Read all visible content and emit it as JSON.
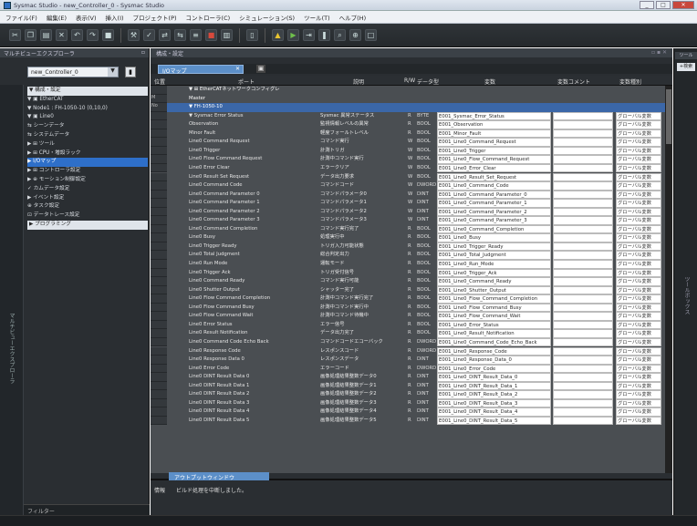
{
  "window": {
    "title": "Sysmac Studio - new_Controller_0 - Sysmac Studio"
  },
  "menu": [
    "ファイル(F)",
    "編集(E)",
    "表示(V)",
    "挿入(I)",
    "プロジェクト(P)",
    "コントローラ(C)",
    "シミュレーション(S)",
    "ツール(T)",
    "ヘルプ(H)"
  ],
  "left": {
    "title": "マルチビューエクスプローラ",
    "controller": "new_Controller_0",
    "vertical_label": "マルチビューエクスプローラ",
    "tree": [
      {
        "label": "▼ 構成・設定",
        "type": "hdr"
      },
      {
        "label": "  ▼ ▣ EtherCAT"
      },
      {
        "label": "    ▼ Node1 : FH-1050-10 (0,10,0)"
      },
      {
        "label": "      ▼ ▣ Line0"
      },
      {
        "label": "          ⇆ シーンデータ"
      },
      {
        "label": "          ⇆ システムデータ"
      },
      {
        "label": "        ▶ ⊞ ツール"
      },
      {
        "label": "  ▶ ⊞ CPU・増設ラック"
      },
      {
        "label": "  ▶ I/Oマップ",
        "type": "sel"
      },
      {
        "label": "  ▶ ⊞ コントローラ設定"
      },
      {
        "label": "  ▶ ⊕ モーション制御設定"
      },
      {
        "label": "     ✓ カムデータ設定"
      },
      {
        "label": "  ▶ イベント設定"
      },
      {
        "label": "     ⊕ タスク設定"
      },
      {
        "label": "     ⊡ データトレース設定"
      },
      {
        "label": "▶ プログラミング",
        "type": "hdr"
      }
    ],
    "filter": "フィルター"
  },
  "main": {
    "title": "構成・設定",
    "tab": "I/Oマップ",
    "columns": {
      "pos": "位置",
      "port": "ポート",
      "desc": "説明",
      "rw": "R/W",
      "dtype": "データ型",
      "var": "変数",
      "vcomment": "変数コメント",
      "vtype": "変数種別"
    },
    "rows": [
      {
        "port": "▼ ⊞ EtherCATネットワークコンフィグレ",
        "grp": true
      },
      {
        "pos": "M",
        "port": "   Master",
        "grp": true
      },
      {
        "pos": "No",
        "port": "  ▼ FH-1050-10",
        "hl": true
      },
      {
        "port": "     ▼ Sysmac Error Status",
        "desc": "Sysmac 異常ステータス",
        "rw": "R",
        "dtype": "BYTE",
        "var": "E001_Sysmac_Error_Status",
        "vtype": "グローバル変数"
      },
      {
        "port": "          Observation",
        "desc": "監視情報レベルの異常",
        "rw": "R",
        "dtype": "BOOL",
        "var": "E001_Observation",
        "vtype": "グローバル変数"
      },
      {
        "port": "          Minor Fault",
        "desc": "軽度フォールトレベル",
        "rw": "R",
        "dtype": "BOOL",
        "var": "E001_Minor_Fault",
        "vtype": "グローバル変数"
      },
      {
        "port": "     Line0 Command Request",
        "desc": "コマンド実行",
        "rw": "W",
        "dtype": "BOOL",
        "var": "E001_Line0_Command_Request",
        "vtype": "グローバル変数"
      },
      {
        "port": "     Line0 Trigger",
        "desc": "計測トリガ",
        "rw": "W",
        "dtype": "BOOL",
        "var": "E001_Line0_Trigger",
        "vtype": "グローバル変数"
      },
      {
        "port": "     Line0 Flow Command Request",
        "desc": "計測中コマンド実行",
        "rw": "W",
        "dtype": "BOOL",
        "var": "E001_Line0_Flow_Command_Request",
        "vtype": "グローバル変数"
      },
      {
        "port": "     Line0 Error Clear",
        "desc": "エラークリア",
        "rw": "W",
        "dtype": "BOOL",
        "var": "E001_Line0_Error_Clear",
        "vtype": "グローバル変数"
      },
      {
        "port": "     Line0 Result Set Request",
        "desc": "データ出力要求",
        "rw": "W",
        "dtype": "BOOL",
        "var": "E001_Line0_Result_Set_Request",
        "vtype": "グローバル変数"
      },
      {
        "port": "     Line0 Command Code",
        "desc": "コマンドコード",
        "rw": "W",
        "dtype": "DWORD",
        "var": "E001_Line0_Command_Code",
        "vtype": "グローバル変数"
      },
      {
        "port": "     Line0 Command Parameter 0",
        "desc": "コマンドパラメータ0",
        "rw": "W",
        "dtype": "DINT",
        "var": "E001_Line0_Command_Parameter_0",
        "vtype": "グローバル変数"
      },
      {
        "port": "     Line0 Command Parameter 1",
        "desc": "コマンドパラメータ1",
        "rw": "W",
        "dtype": "DINT",
        "var": "E001_Line0_Command_Parameter_1",
        "vtype": "グローバル変数"
      },
      {
        "port": "     Line0 Command Parameter 2",
        "desc": "コマンドパラメータ2",
        "rw": "W",
        "dtype": "DINT",
        "var": "E001_Line0_Command_Parameter_2",
        "vtype": "グローバル変数"
      },
      {
        "port": "     Line0 Command Parameter 3",
        "desc": "コマンドパラメータ3",
        "rw": "W",
        "dtype": "DINT",
        "var": "E001_Line0_Command_Parameter_3",
        "vtype": "グローバル変数"
      },
      {
        "port": "     Line0 Command Completion",
        "desc": "コマンド実行完了",
        "rw": "R",
        "dtype": "BOOL",
        "var": "E001_Line0_Command_Completion",
        "vtype": "グローバル変数"
      },
      {
        "port": "     Line0 Busy",
        "desc": "処理実行中",
        "rw": "R",
        "dtype": "BOOL",
        "var": "E001_Line0_Busy",
        "vtype": "グローバル変数"
      },
      {
        "port": "     Line0 Trigger Ready",
        "desc": "トリガ入力可能状態",
        "rw": "R",
        "dtype": "BOOL",
        "var": "E001_Line0_Trigger_Ready",
        "vtype": "グローバル変数"
      },
      {
        "port": "     Line0 Total Judgment",
        "desc": "総合判定出力",
        "rw": "R",
        "dtype": "BOOL",
        "var": "E001_Line0_Total_Judgment",
        "vtype": "グローバル変数"
      },
      {
        "port": "     Line0 Run Mode",
        "desc": "運転モード",
        "rw": "R",
        "dtype": "BOOL",
        "var": "E001_Line0_Run_Mode",
        "vtype": "グローバル変数"
      },
      {
        "port": "     Line0 Trigger Ack",
        "desc": "トリガ受付信号",
        "rw": "R",
        "dtype": "BOOL",
        "var": "E001_Line0_Trigger_Ack",
        "vtype": "グローバル変数"
      },
      {
        "port": "     Line0 Command Ready",
        "desc": "コマンド実行可能",
        "rw": "R",
        "dtype": "BOOL",
        "var": "E001_Line0_Command_Ready",
        "vtype": "グローバル変数"
      },
      {
        "port": "     Line0 Shutter Output",
        "desc": "シャッター完了",
        "rw": "R",
        "dtype": "BOOL",
        "var": "E001_Line0_Shutter_Output",
        "vtype": "グローバル変数"
      },
      {
        "port": "     Line0 Flow Command Completion",
        "desc": "計測中コマンド実行完了",
        "rw": "R",
        "dtype": "BOOL",
        "var": "E001_Line0_Flow_Command_Completion",
        "vtype": "グローバル変数"
      },
      {
        "port": "     Line0 Flow Command Busy",
        "desc": "計測中コマンド実行中",
        "rw": "R",
        "dtype": "BOOL",
        "var": "E001_Line0_Flow_Command_Busy",
        "vtype": "グローバル変数"
      },
      {
        "port": "     Line0 Flow Command Wait",
        "desc": "計測中コマンド待機中",
        "rw": "R",
        "dtype": "BOOL",
        "var": "E001_Line0_Flow_Command_Wait",
        "vtype": "グローバル変数"
      },
      {
        "port": "     Line0 Error Status",
        "desc": "エラー信号",
        "rw": "R",
        "dtype": "BOOL",
        "var": "E001_Line0_Error_Status",
        "vtype": "グローバル変数"
      },
      {
        "port": "     Line0 Result Notification",
        "desc": "データ出力完了",
        "rw": "R",
        "dtype": "BOOL",
        "var": "E001_Line0_Result_Notification",
        "vtype": "グローバル変数"
      },
      {
        "port": "     Line0 Command Code Echo Back",
        "desc": "コマンドコードエコーバック",
        "rw": "R",
        "dtype": "DWORD",
        "var": "E001_Line0_Command_Code_Echo_Back",
        "vtype": "グローバル変数"
      },
      {
        "port": "     Line0 Response Code",
        "desc": "レスポンスコード",
        "rw": "R",
        "dtype": "DWORD",
        "var": "E001_Line0_Response_Code",
        "vtype": "グローバル変数"
      },
      {
        "port": "     Line0 Response Data 0",
        "desc": "レスポンスデータ",
        "rw": "R",
        "dtype": "DINT",
        "var": "E001_Line0_Response_Data_0",
        "vtype": "グローバル変数"
      },
      {
        "port": "     Line0 Error Code",
        "desc": "エラーコード",
        "rw": "R",
        "dtype": "DWORD",
        "var": "E001_Line0_Error_Code",
        "vtype": "グローバル変数"
      },
      {
        "port": "     Line0 DINT Result Data 0",
        "desc": "画像処理結果整数データ0",
        "rw": "R",
        "dtype": "DINT",
        "var": "E001_Line0_DINT_Result_Data_0",
        "vtype": "グローバル変数"
      },
      {
        "port": "     Line0 DINT Result Data 1",
        "desc": "画像処理結果整数データ1",
        "rw": "R",
        "dtype": "DINT",
        "var": "E001_Line0_DINT_Result_Data_1",
        "vtype": "グローバル変数"
      },
      {
        "port": "     Line0 DINT Result Data 2",
        "desc": "画像処理結果整数データ2",
        "rw": "R",
        "dtype": "DINT",
        "var": "E001_Line0_DINT_Result_Data_2",
        "vtype": "グローバル変数"
      },
      {
        "port": "     Line0 DINT Result Data 3",
        "desc": "画像処理結果整数データ3",
        "rw": "R",
        "dtype": "DINT",
        "var": "E001_Line0_DINT_Result_Data_3",
        "vtype": "グローバル変数"
      },
      {
        "port": "     Line0 DINT Result Data 4",
        "desc": "画像処理結果整数データ4",
        "rw": "R",
        "dtype": "DINT",
        "var": "E001_Line0_DINT_Result_Data_4",
        "vtype": "グローバル変数"
      },
      {
        "port": "     Line0 DINT Result Data 5",
        "desc": "画像処理結果整数データ5",
        "rw": "R",
        "dtype": "DINT",
        "var": "E001_Line0_DINT_Result_Data_5",
        "vtype": "グローバル変数"
      }
    ]
  },
  "output": {
    "tab": "アウトプットウィンドウ",
    "level": "情報",
    "message": "ビルド処理を中断しました。"
  },
  "right": {
    "tab": "ツール",
    "button": "+検索",
    "vertical_label": "ツールボックス"
  }
}
